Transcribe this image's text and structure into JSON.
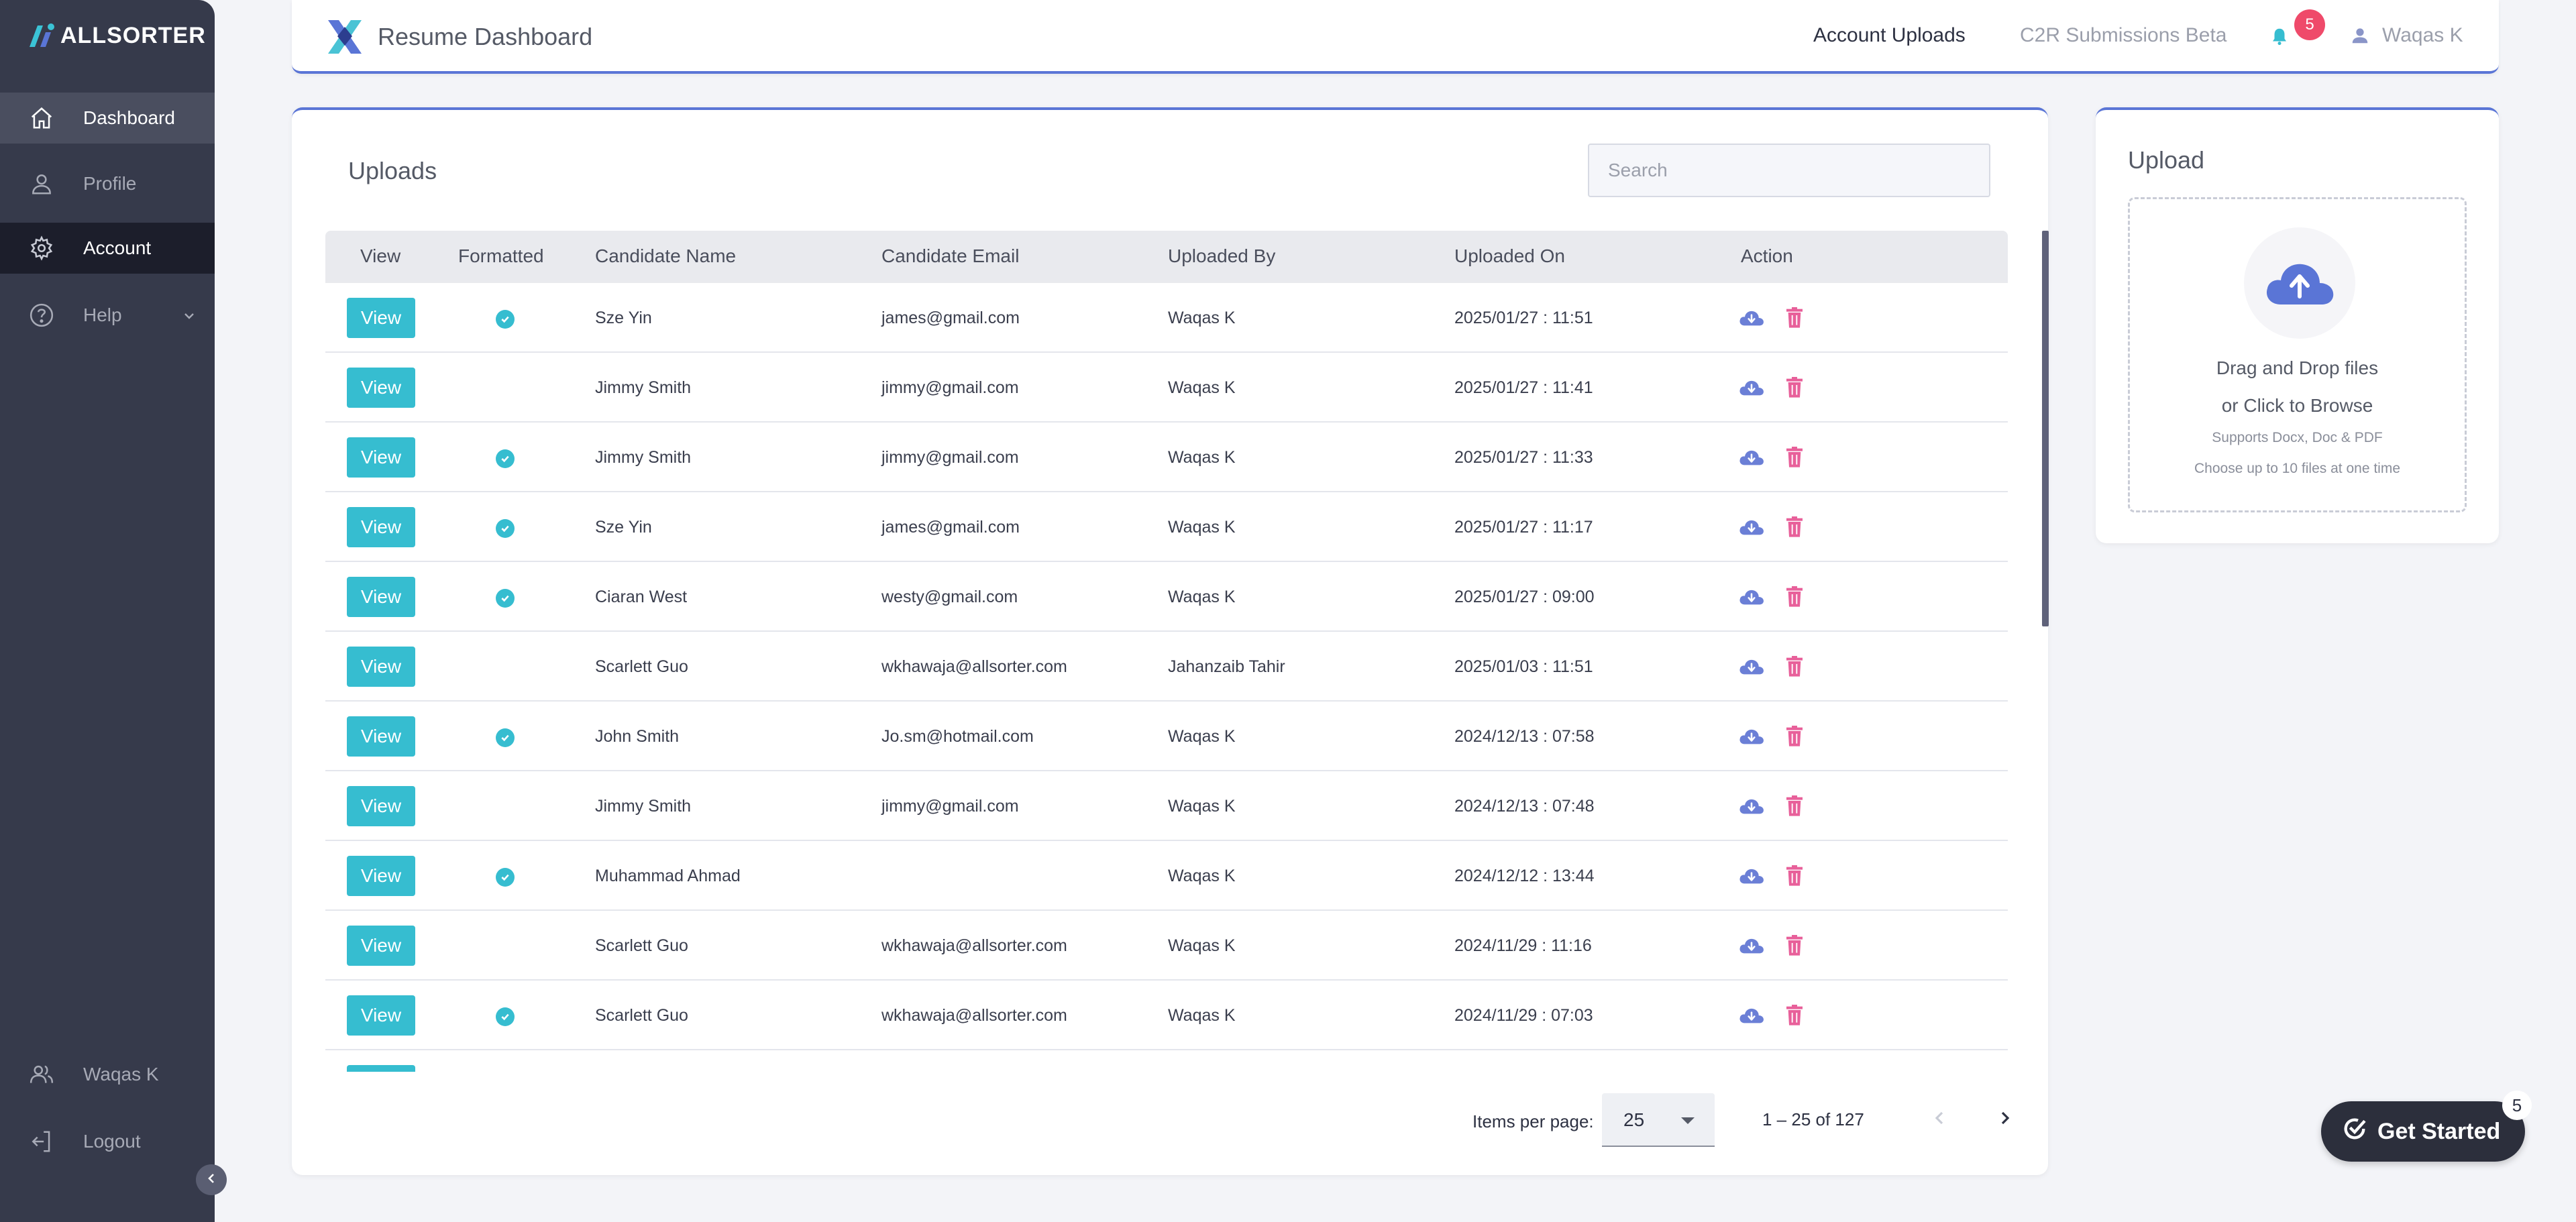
{
  "brand": {
    "name": "ALLSORTER"
  },
  "sidebar": {
    "items": [
      {
        "label": "Dashboard",
        "icon": "home-icon"
      },
      {
        "label": "Profile",
        "icon": "person-icon"
      },
      {
        "label": "Account",
        "icon": "gear-icon"
      },
      {
        "label": "Help",
        "icon": "help-circle-icon"
      }
    ],
    "user": "Waqas K",
    "logout": "Logout"
  },
  "header": {
    "title": "Resume Dashboard",
    "nav": [
      "Account Uploads",
      "C2R Submissions Beta"
    ],
    "notification_count": "5",
    "user": "Waqas K"
  },
  "uploads": {
    "title": "Uploads",
    "search_placeholder": "Search",
    "columns": [
      "View",
      "Formatted",
      "Candidate Name",
      "Candidate Email",
      "Uploaded By",
      "Uploaded On",
      "Action"
    ],
    "view_label": "View",
    "rows": [
      {
        "formatted": true,
        "name": "Sze Yin",
        "email": "james@gmail.com",
        "by": "Waqas K",
        "on": "2025/01/27 : 11:51"
      },
      {
        "formatted": false,
        "name": "Jimmy Smith",
        "email": "jimmy@gmail.com",
        "by": "Waqas K",
        "on": "2025/01/27 : 11:41"
      },
      {
        "formatted": true,
        "name": "Jimmy Smith",
        "email": "jimmy@gmail.com",
        "by": "Waqas K",
        "on": "2025/01/27 : 11:33"
      },
      {
        "formatted": true,
        "name": "Sze Yin",
        "email": "james@gmail.com",
        "by": "Waqas K",
        "on": "2025/01/27 : 11:17"
      },
      {
        "formatted": true,
        "name": "Ciaran West",
        "email": "westy@gmail.com",
        "by": "Waqas K",
        "on": "2025/01/27 : 09:00"
      },
      {
        "formatted": false,
        "name": "Scarlett Guo",
        "email": "wkhawaja@allsorter.com",
        "by": "Jahanzaib Tahir",
        "on": "2025/01/03 : 11:51"
      },
      {
        "formatted": true,
        "name": "John Smith",
        "email": "Jo.sm@hotmail.com",
        "by": "Waqas K",
        "on": "2024/12/13 : 07:58"
      },
      {
        "formatted": false,
        "name": "Jimmy Smith",
        "email": "jimmy@gmail.com",
        "by": "Waqas K",
        "on": "2024/12/13 : 07:48"
      },
      {
        "formatted": true,
        "name": "Muhammad Ahmad",
        "email": "",
        "by": "Waqas K",
        "on": "2024/12/12 : 13:44"
      },
      {
        "formatted": false,
        "name": "Scarlett Guo",
        "email": "wkhawaja@allsorter.com",
        "by": "Waqas K",
        "on": "2024/11/29 : 11:16"
      },
      {
        "formatted": true,
        "name": "Scarlett Guo",
        "email": "wkhawaja@allsorter.com",
        "by": "Waqas K",
        "on": "2024/11/29 : 07:03"
      },
      {
        "formatted": false,
        "name": "",
        "email": "",
        "by": "",
        "on": ""
      }
    ],
    "pager": {
      "label": "Items per page:",
      "per_page": "25",
      "range": "1 – 25 of 127"
    }
  },
  "upload": {
    "title": "Upload",
    "line1": "Drag and Drop files",
    "line2": "or Click to Browse",
    "line3": "Supports Docx, Doc & PDF",
    "line4": "Choose up to 10 files at one time"
  },
  "get_started": {
    "label": "Get Started",
    "count": "5"
  },
  "colors": {
    "accent": "#36bdd0",
    "brand": "#5a75d6",
    "sidebar": "#363a4b",
    "danger": "#e8609a",
    "badge": "#ef4a6a"
  }
}
